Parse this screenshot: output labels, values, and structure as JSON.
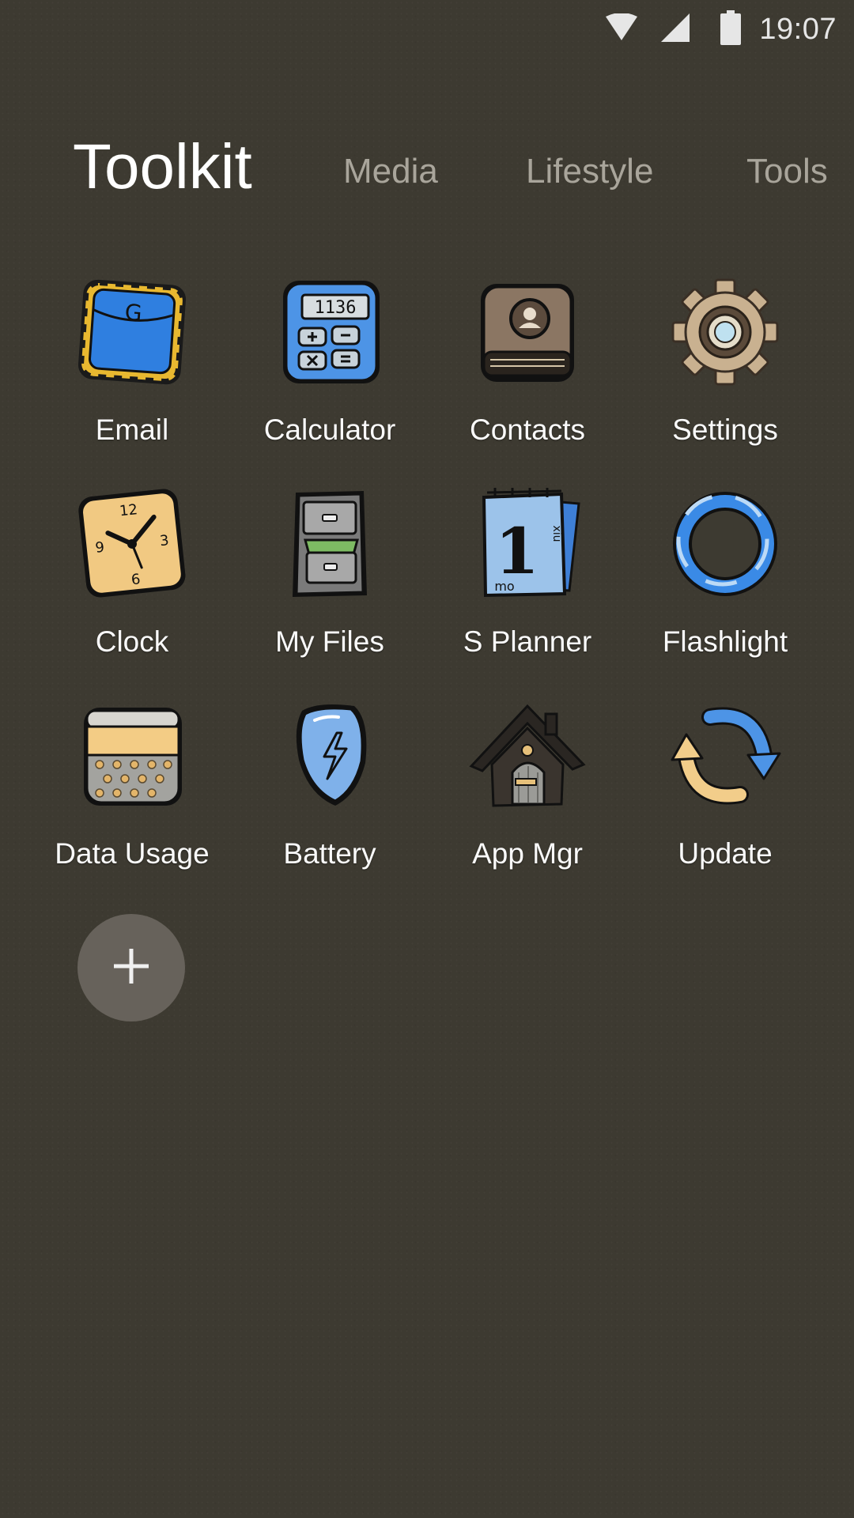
{
  "status_bar": {
    "time": "19:07",
    "icons": [
      "wifi-icon",
      "signal-icon",
      "battery-icon"
    ]
  },
  "tabs": [
    {
      "label": "Toolkit",
      "active": true
    },
    {
      "label": "Media",
      "active": false
    },
    {
      "label": "Lifestyle",
      "active": false
    },
    {
      "label": "Tools",
      "active": false
    }
  ],
  "apps": [
    {
      "label": "Email",
      "icon": "email-icon"
    },
    {
      "label": "Calculator",
      "icon": "calculator-icon"
    },
    {
      "label": "Contacts",
      "icon": "contacts-icon"
    },
    {
      "label": "Settings",
      "icon": "settings-gear-icon"
    },
    {
      "label": "Clock",
      "icon": "clock-icon"
    },
    {
      "label": "My Files",
      "icon": "file-cabinet-icon"
    },
    {
      "label": "S Planner",
      "icon": "calendar-icon"
    },
    {
      "label": "Flashlight",
      "icon": "flashlight-ring-icon"
    },
    {
      "label": "Data Usage",
      "icon": "data-usage-icon"
    },
    {
      "label": "Battery",
      "icon": "battery-shield-icon"
    },
    {
      "label": "App Mgr",
      "icon": "house-icon"
    },
    {
      "label": "Update",
      "icon": "refresh-arrows-icon"
    }
  ],
  "add_button": {
    "icon": "plus-icon"
  },
  "icon_text": {
    "email_letter": "G",
    "calculator_display": "1136",
    "calendar_day": "1",
    "calendar_month": "mo",
    "calendar_side": "xiu",
    "clock_numbers": [
      "12",
      "3",
      "6",
      "9"
    ]
  },
  "colors": {
    "background": "#3d3a31",
    "accent_blue": "#4a90e2",
    "accent_tan": "#f2cd8a",
    "inactive_tab": "#a9a59b"
  }
}
